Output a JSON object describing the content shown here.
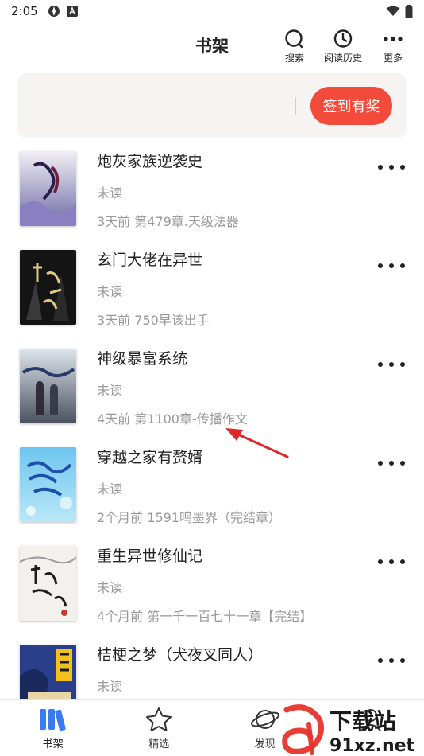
{
  "status_bar": {
    "time": "2:05"
  },
  "header": {
    "title": "书架",
    "actions": [
      {
        "label": "搜索",
        "icon": "search-icon"
      },
      {
        "label": "阅读历史",
        "icon": "clock-icon"
      },
      {
        "label": "更多",
        "icon": "more-dots-icon"
      }
    ]
  },
  "banner": {
    "signin_label": "签到有奖",
    "accent": "#f24a3b"
  },
  "books": [
    {
      "title": "炮灰家族逆袭史",
      "status": "未读",
      "latest": "3天前 第479章.天级法器"
    },
    {
      "title": "玄门大佬在异世",
      "status": "未读",
      "latest": "3天前 750早该出手"
    },
    {
      "title": "神级暴富系统",
      "status": "未读",
      "latest": "4天前 第1100章-传播作文"
    },
    {
      "title": "穿越之家有赘婿",
      "status": "未读",
      "latest": "2个月前 1591鸣墨界（完结章）"
    },
    {
      "title": "重生异世修仙记",
      "status": "未读",
      "latest": "4个月前 第一千一百七十一章【完结】"
    },
    {
      "title": "桔梗之梦（犬夜叉同人）",
      "status": "未读",
      "latest": ""
    }
  ],
  "bottom_nav": [
    {
      "label": "书架",
      "icon": "bookshelf-icon",
      "active": true
    },
    {
      "label": "精选",
      "icon": "star-icon",
      "active": false
    },
    {
      "label": "发现",
      "icon": "planet-icon",
      "active": false
    },
    {
      "label": "",
      "icon": "profile-icon",
      "active": false
    }
  ],
  "watermark": {
    "brand": "下载站",
    "domain": "91xz.net"
  },
  "colors": {
    "accent_red": "#f24a3b",
    "nav_active_blue": "#3a7bf0",
    "muted_text": "#999999"
  }
}
